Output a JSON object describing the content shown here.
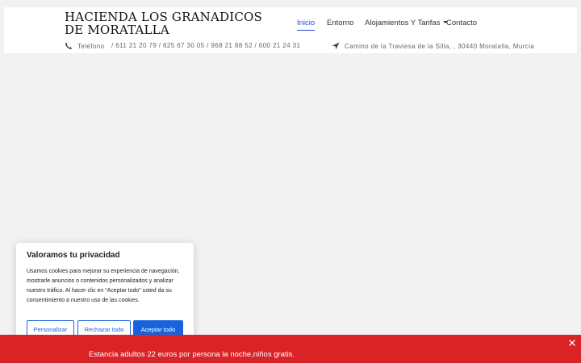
{
  "site": {
    "title": "HACIENDA LOS GRANADICOS DE MORATALLA"
  },
  "nav": {
    "items": [
      {
        "label": "Inicio",
        "active": true
      },
      {
        "label": "Entorno"
      },
      {
        "label": "Alojamientos Y Tarifas",
        "has_dropdown": true
      },
      {
        "label": "Contacto"
      }
    ]
  },
  "contact": {
    "phone_label": "Teléfono",
    "phone_numbers": "/ 611 21 20 79 / 625 67 30 05 / 968 21 88 52 / 600 21 24 31",
    "address": "Camino de la Traviesa de la Silla, , 30440 Moratalla, Murcia",
    "phone_icon": "phone-icon",
    "location_icon": "location-arrow-icon"
  },
  "cookie": {
    "title": "Valoramos tu privacidad",
    "text": "Usamos cookies para mejorar su experiencia de navegación, mostrarle anuncios o contenidos personalizados y analizar nuestro tráfico. Al hacer clic en “Aceptar todo” usted da su consentimiento a nuestro uso de las cookies.",
    "customize_label": "Personalizar",
    "reject_label": "Rechazar todo",
    "accept_label": "Aceptar todo"
  },
  "banner": {
    "text": "Estancia adultos 22 euros por persona la noche,niños gratis.",
    "close_icon": "close-icon"
  },
  "colors": {
    "accent": "#2a4bd6",
    "cookie_button": "#1863dc",
    "banner": "#d92326"
  }
}
